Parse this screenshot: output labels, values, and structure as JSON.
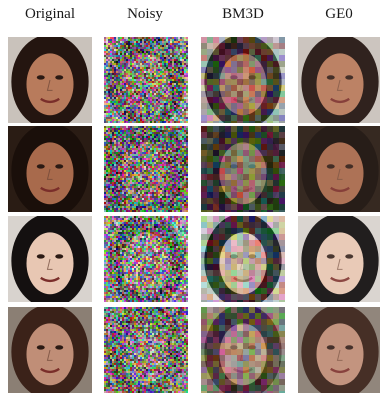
{
  "figure": {
    "columns": [
      "Original",
      "Noisy",
      "BM3D",
      "GE0"
    ],
    "rows": [
      {
        "skin": "#b87b5c",
        "hair": "#241510",
        "bg": "#c9c2bb"
      },
      {
        "skin": "#a86a4c",
        "hair": "#1a0f0a",
        "bg": "#2a1c14"
      },
      {
        "skin": "#e8c7b3",
        "hair": "#141010",
        "bg": "#d8d3ce"
      },
      {
        "skin": "#c08e77",
        "hair": "#3b2219",
        "bg": "#8b7f74"
      }
    ]
  }
}
